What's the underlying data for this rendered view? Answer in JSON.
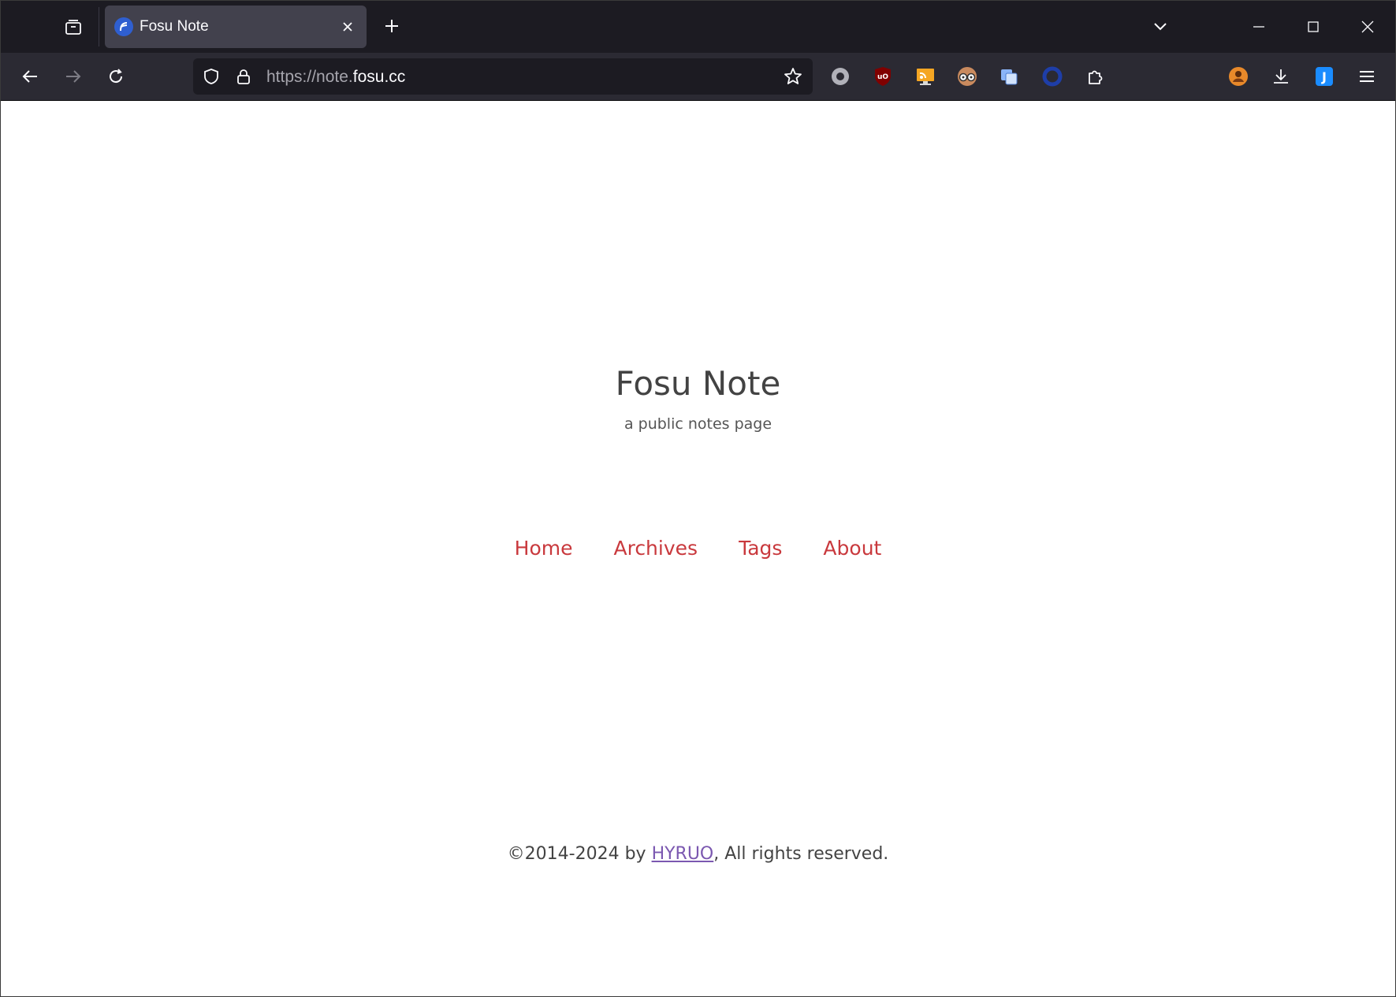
{
  "browser": {
    "tab": {
      "title": "Fosu Note"
    },
    "url": {
      "scheme_prefix": "https://note.",
      "domain": "fosu.cc"
    },
    "toolbar_icons": [
      "back-icon",
      "forward-icon",
      "reload-icon",
      "shield-icon",
      "lock-icon",
      "bookmark-star-icon",
      "extension-circle-icon",
      "ublock-icon",
      "rss-icon",
      "glasses-icon",
      "translate-icon",
      "blue-ring-icon",
      "extensions-puzzle-icon",
      "profile-avatar-icon",
      "downloads-icon",
      "j-extension-icon",
      "menu-icon"
    ],
    "colors": {
      "tabstrip_bg": "#1c1b22",
      "toolbar_bg": "#2b2a33",
      "active_tab_bg": "#42414d"
    }
  },
  "site": {
    "title": "Fosu Note",
    "subtitle": "a public notes page",
    "nav": [
      {
        "label": "Home"
      },
      {
        "label": "Archives"
      },
      {
        "label": "Tags"
      },
      {
        "label": "About"
      }
    ],
    "footer": {
      "prefix": "©2014-2024 by ",
      "author": "HYRUO",
      "suffix": ", All rights reserved."
    },
    "colors": {
      "link": "#c9393d",
      "author_link": "#7b58b0",
      "text": "#434343"
    }
  }
}
